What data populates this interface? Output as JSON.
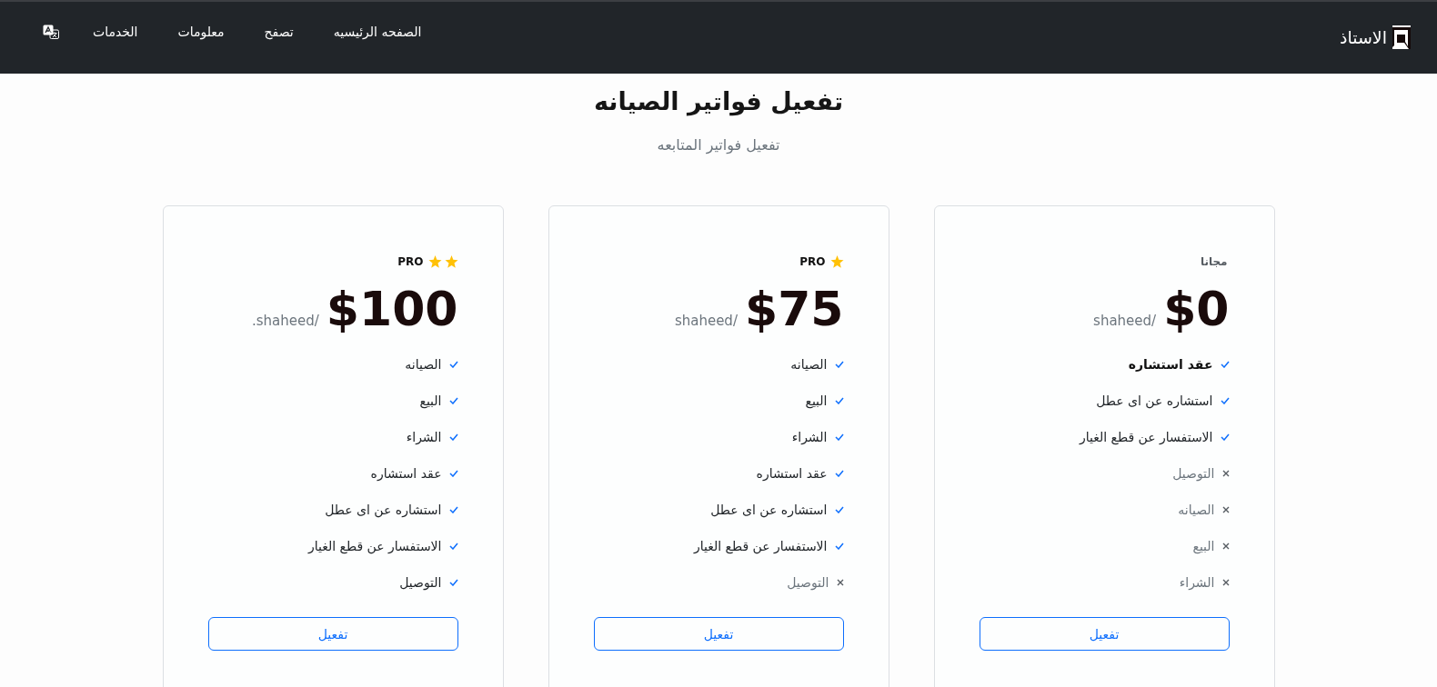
{
  "navbar": {
    "brand": "الاستاذ",
    "links": [
      {
        "label": "الصفحه الرئيسيه"
      },
      {
        "label": "تصفح"
      },
      {
        "label": "معلومات"
      },
      {
        "label": "الخدمات"
      }
    ]
  },
  "hero": {
    "title": "تفعيل فواتير الصيانه",
    "subtitle": "تفعيل فواتير المتابعه"
  },
  "plans": [
    {
      "tier": "مجانا",
      "price": "$0",
      "period": "shaheed/",
      "features": [
        {
          "label": "عقد استشاره",
          "kind": "included",
          "emphasized": true
        },
        {
          "label": "استشاره عن اى عطل",
          "kind": "included",
          "emphasized": false
        },
        {
          "label": "الاستفسار عن قطع الغيار",
          "kind": "included",
          "emphasized": false
        },
        {
          "label": "التوصيل",
          "kind": "excluded",
          "emphasized": false
        },
        {
          "label": "الصيانه",
          "kind": "excluded",
          "emphasized": false
        },
        {
          "label": "البيع",
          "kind": "excluded",
          "emphasized": false
        },
        {
          "label": "الشراء",
          "kind": "excluded",
          "emphasized": false
        }
      ],
      "button": "تفعيل"
    },
    {
      "tier": "PRO",
      "stars": 1,
      "price": "$75",
      "period": "shaheed/",
      "features": [
        {
          "label": "الصيانه",
          "kind": "included",
          "emphasized": false
        },
        {
          "label": "البيع",
          "kind": "included",
          "emphasized": false
        },
        {
          "label": "الشراء",
          "kind": "included",
          "emphasized": false
        },
        {
          "label": "عقد استشاره",
          "kind": "included",
          "emphasized": false
        },
        {
          "label": "استشاره عن اى عطل",
          "kind": "included",
          "emphasized": false
        },
        {
          "label": "الاستفسار عن قطع الغيار",
          "kind": "included",
          "emphasized": false
        },
        {
          "label": "التوصيل",
          "kind": "excluded",
          "emphasized": false
        }
      ],
      "button": "تفعيل"
    },
    {
      "tier": "PRO",
      "stars": 2,
      "price": "$100",
      "period": ".shaheed/",
      "features": [
        {
          "label": "الصيانه",
          "kind": "included",
          "emphasized": false
        },
        {
          "label": "البيع",
          "kind": "included",
          "emphasized": false
        },
        {
          "label": "الشراء",
          "kind": "included",
          "emphasized": false
        },
        {
          "label": "عقد استشاره",
          "kind": "included",
          "emphasized": false
        },
        {
          "label": "استشاره عن اى عطل",
          "kind": "included",
          "emphasized": false
        },
        {
          "label": "الاستفسار عن قطع الغيار",
          "kind": "included",
          "emphasized": false
        },
        {
          "label": "التوصيل",
          "kind": "included",
          "emphasized": false
        }
      ],
      "button": "تفعيل"
    }
  ]
}
